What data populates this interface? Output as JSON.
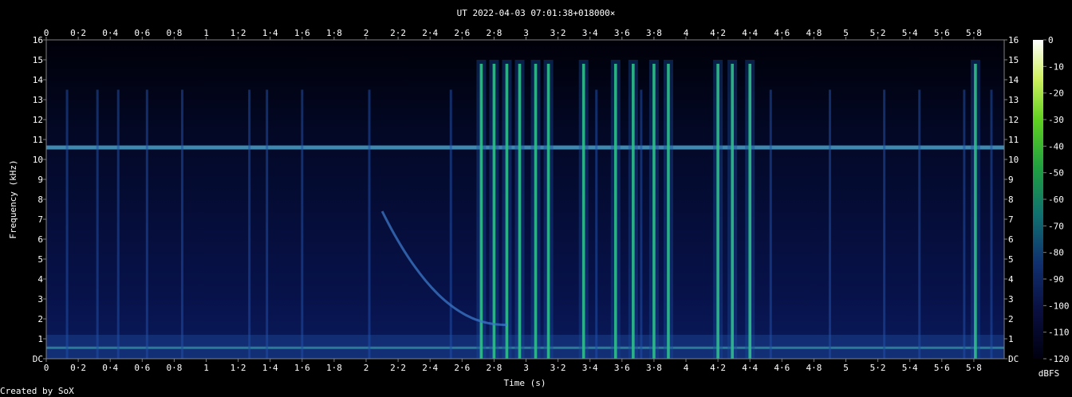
{
  "chart_data": {
    "type": "heatmap",
    "title": "UT 2022-04-03 07:01:38+018000×",
    "xlabel": "Time (s)",
    "ylabel": "Frequency (kHz)",
    "xlim": [
      0,
      5.99
    ],
    "ylim": [
      0,
      16
    ],
    "x_ticks": [
      "0",
      "0·2",
      "0·4",
      "0·6",
      "0·8",
      "1",
      "1·2",
      "1·4",
      "1·6",
      "1·8",
      "2",
      "2·2",
      "2·4",
      "2·6",
      "2·8",
      "3",
      "3·2",
      "3·4",
      "3·6",
      "3·8",
      "4",
      "4·2",
      "4·4",
      "4·6",
      "4·8",
      "5",
      "5·2",
      "5·4",
      "5·6",
      "5·8"
    ],
    "y_ticks": [
      "DC",
      "1",
      "2",
      "3",
      "4",
      "5",
      "6",
      "7",
      "8",
      "9",
      "10",
      "11",
      "12",
      "13",
      "14",
      "15",
      "16"
    ],
    "colorbar": {
      "label": "dBFS",
      "ticks": [
        "0",
        "-10",
        "-20",
        "-30",
        "-40",
        "-50",
        "-60",
        "-70",
        "-80",
        "-90",
        "-100",
        "-110",
        "-120"
      ],
      "range": [
        -120,
        0
      ]
    },
    "features": {
      "tone_khz": 10.6,
      "low_band_khz": 0.55,
      "bright_pulses_s": [
        2.72,
        2.8,
        2.88,
        2.96,
        3.06,
        3.14,
        3.36,
        3.56,
        3.67,
        3.8,
        3.89,
        4.2,
        4.29,
        4.4,
        5.81
      ],
      "faint_pulses_s": [
        0.13,
        0.32,
        0.45,
        0.63,
        0.85,
        1.27,
        1.38,
        1.6,
        2.02,
        2.53,
        3.44,
        3.72,
        4.53,
        4.9,
        5.24,
        5.46,
        5.74,
        5.91
      ],
      "chirp": {
        "start_s": 2.1,
        "start_khz": 7.4,
        "end_s": 2.88,
        "end_khz": 1.7
      }
    }
  },
  "footer": {
    "credit": "Created by SoX"
  }
}
